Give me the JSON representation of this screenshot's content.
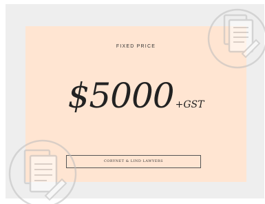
{
  "card": {
    "heading": "FIXED PRICE",
    "price": "$5000",
    "price_suffix": "+GST",
    "firm_name": "CORYNET & LIND LAWYERS"
  },
  "colors": {
    "background": "#ffffff",
    "band": "#eeeeee",
    "card": "#ffe5d2",
    "text": "#222222",
    "watermark": "#cccccc"
  },
  "icons": {
    "top_right": "document-contract-icon",
    "bottom_left": "document-contract-icon"
  }
}
